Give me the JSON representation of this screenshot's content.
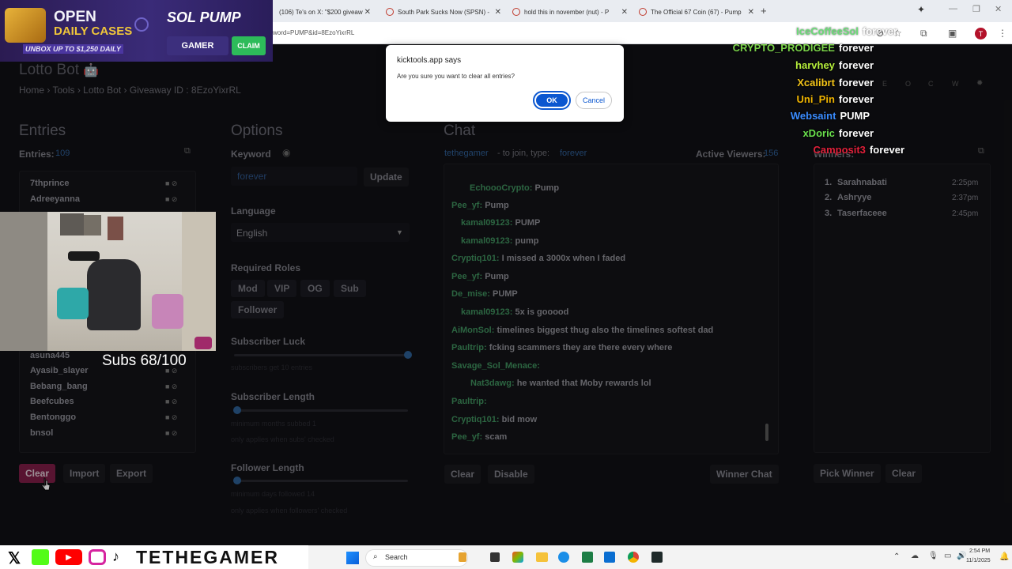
{
  "browser": {
    "tabs": [
      {
        "label": "(106) Te's on X: \"$200 giveaw"
      },
      {
        "label": "South Park Sucks Now (SPSN) -"
      },
      {
        "label": "hold this in november (nut) - P"
      },
      {
        "label": "The Official 67 Coin (67) - Pump"
      }
    ],
    "url": "word=PUMP&id=8EzoYixrRL",
    "profile_initial": "T"
  },
  "ad": {
    "open": "OPEN",
    "daily_cases": "DAILY CASES",
    "unbox": "UNBOX UP TO $1,250 DAILY",
    "brand": "SOL PUMP",
    "gamer": "GAMER",
    "claim": "CLAIM"
  },
  "app": {
    "title": "Lotto Bot",
    "breadcrumb": {
      "home": "Home",
      "tools": "Tools",
      "lotto": "Lotto Bot",
      "giveaway": "Giveaway ID : 8EzoYixrRL"
    }
  },
  "entries": {
    "heading": "Entries",
    "label": "Entries:",
    "count": "109",
    "top_items": [
      "7thprince",
      "Adreeyanna"
    ],
    "items": [
      "asuna445",
      "Ayasib_slayer",
      "Bebang_bang",
      "Beefcubes",
      "Bentonggo",
      "bnsol"
    ],
    "buttons": {
      "clear": "Clear",
      "import": "Import",
      "export": "Export"
    }
  },
  "options": {
    "heading": "Options",
    "keyword_label": "Keyword",
    "keyword_value": "forever",
    "update": "Update",
    "language_label": "Language",
    "language_value": "English",
    "required_roles_label": "Required Roles",
    "roles": [
      "Mod",
      "VIP",
      "OG",
      "Sub",
      "Follower"
    ],
    "sub_luck_label": "Subscriber Luck",
    "sub_luck_hint": "subscribers get 10 entries",
    "sub_luck_fraction": 1.0,
    "sub_length_label": "Subscriber Length",
    "sub_length_hint1": "minimum months subbed 1",
    "sub_length_hint2": "only applies when subs' checked",
    "sub_length_fraction": 0.02,
    "follower_length_label": "Follower Length",
    "follower_length_hint1": "minimum days followed 14",
    "follower_length_hint2": "only applies when followers' checked",
    "follower_length_fraction": 0.02
  },
  "chat": {
    "heading": "Chat",
    "streamer": "tethegamer",
    "join_text": "- to join, type:",
    "join_keyword": "forever",
    "active_label": "Active Viewers:",
    "active_count": "156",
    "messages": [
      {
        "user": "EchoooCrypto:",
        "text": "Pump"
      },
      {
        "user": "Pee_yf:",
        "text": "Pump"
      },
      {
        "user": "kamal09123:",
        "text": "PUMP"
      },
      {
        "user": "kamal09123:",
        "text": "pump"
      },
      {
        "user": "Cryptiq101:",
        "text": "I missed a 3000x when I faded"
      },
      {
        "user": "Pee_yf:",
        "text": "Pump"
      },
      {
        "user": "De_mise:",
        "text": "PUMP"
      },
      {
        "user": "kamal09123:",
        "text": "5x is gooood"
      },
      {
        "user": "AiMonSol:",
        "text": "timelines biggest thug also the timelines softest dad"
      },
      {
        "user": "Paultrip:",
        "text": "fcking scammers they are there every where"
      },
      {
        "user": "Savage_Sol_Menace:",
        "text": ""
      },
      {
        "user": "Nat3dawg:",
        "text": "he wanted that Moby rewards lol"
      },
      {
        "user": "Paultrip:",
        "text": ""
      },
      {
        "user": "Cryptiq101:",
        "text": "bid mow"
      },
      {
        "user": "Pee_yf:",
        "text": "scam"
      }
    ],
    "buttons": {
      "clear": "Clear",
      "disable": "Disable",
      "winner_chat": "Winner Chat"
    }
  },
  "winners": {
    "heading": "Winners:",
    "letters": [
      "E",
      "O",
      "C",
      "W"
    ],
    "list": [
      {
        "rank": "1.",
        "name": "Sarahnabati",
        "time": "2:25pm"
      },
      {
        "rank": "2.",
        "name": "Ashryye",
        "time": "2:37pm"
      },
      {
        "rank": "3.",
        "name": "Taserfaceee",
        "time": "2:45pm"
      }
    ],
    "buttons": {
      "pick": "Pick Winner",
      "clear": "Clear"
    }
  },
  "dialog": {
    "title": "kicktools.app says",
    "message": "Are you sure you want to clear all entries?",
    "ok": "OK",
    "cancel": "Cancel"
  },
  "stream": {
    "subs": "Subs 68/100",
    "channel": "TETHEGAMER",
    "feed": [
      {
        "user": "IceCoffeeSol",
        "word": "forever",
        "color": "#2ecc40"
      },
      {
        "user": "CRYPTO_PRODIGEE",
        "word": "forever",
        "color": "#7bd44a"
      },
      {
        "user": "harvhey",
        "word": "forever",
        "color": "#b7f03c"
      },
      {
        "user": "Xcalibrt",
        "word": "forever",
        "color": "#f5c518"
      },
      {
        "user": "Uni_Pin",
        "word": "forever",
        "color": "#f0b400"
      },
      {
        "user": "Websaint",
        "word": "PUMP",
        "color": "#3a8cff"
      },
      {
        "user": "xDoric",
        "word": "forever",
        "color": "#6ae04d"
      },
      {
        "user": "Camposit3",
        "word": "forever",
        "color": "#e0203a"
      }
    ]
  },
  "taskbar": {
    "search": "Search",
    "time": "2:54 PM",
    "date": "11/1/2025"
  }
}
